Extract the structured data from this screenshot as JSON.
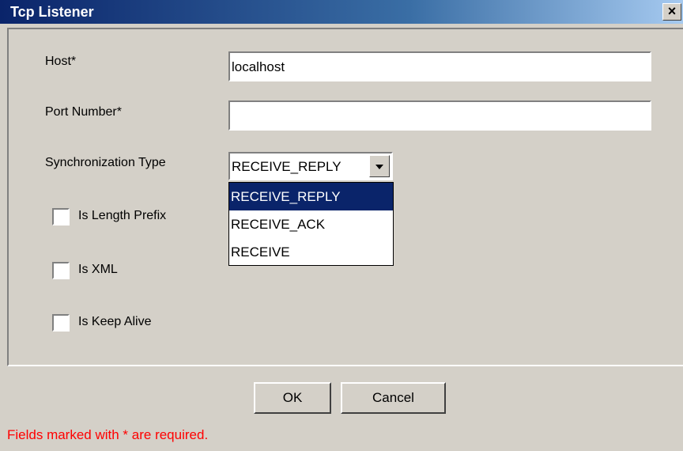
{
  "window": {
    "title": "Tcp Listener",
    "close_label": "×"
  },
  "form": {
    "host": {
      "label": "Host*",
      "value": "localhost"
    },
    "port": {
      "label": "Port Number*",
      "value": ""
    },
    "sync": {
      "label": "Synchronization Type",
      "value": "RECEIVE_REPLY",
      "options": [
        "RECEIVE_REPLY",
        "RECEIVE_ACK",
        "RECEIVE"
      ],
      "selected_index": 0
    },
    "checkboxes": [
      {
        "label": "Is Length Prefix",
        "checked": false
      },
      {
        "label": "Is XML",
        "checked": false
      },
      {
        "label": "Is Keep Alive",
        "checked": false
      }
    ]
  },
  "buttons": {
    "ok": "OK",
    "cancel": "Cancel"
  },
  "footer": {
    "required_note": "Fields marked with * are required.",
    "note_color": "#ff0000"
  }
}
